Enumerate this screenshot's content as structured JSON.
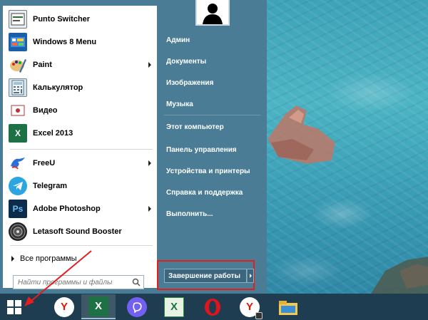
{
  "start_menu": {
    "pinned_apps": [
      {
        "label": "Punto Switcher",
        "icon": "punto-switcher-icon",
        "has_submenu": false
      },
      {
        "label": "Windows 8 Menu",
        "icon": "windows8-menu-icon",
        "has_submenu": false
      },
      {
        "label": "Paint",
        "icon": "paint-icon",
        "has_submenu": true
      },
      {
        "label": "Калькулятор",
        "icon": "calculator-icon",
        "has_submenu": false
      },
      {
        "label": "Видео",
        "icon": "video-icon",
        "has_submenu": false
      },
      {
        "label": "Excel 2013",
        "icon": "excel-icon",
        "has_submenu": false
      }
    ],
    "recent_apps": [
      {
        "label": "FreeU",
        "icon": "freeu-icon",
        "has_submenu": true
      },
      {
        "label": "Telegram",
        "icon": "telegram-icon",
        "has_submenu": false
      },
      {
        "label": "Adobe Photoshop",
        "icon": "photoshop-icon",
        "has_submenu": true
      },
      {
        "label": "Letasoft Sound Booster",
        "icon": "sound-booster-icon",
        "has_submenu": false
      }
    ],
    "all_programs": "Все программы",
    "search": {
      "placeholder": "Найти программы и файлы"
    },
    "right_items": [
      "Админ",
      "Документы",
      "Изображения",
      "Музыка",
      "Этот компьютер",
      "Панель управления",
      "Устройства и принтеры",
      "Справка и поддержка",
      "Выполнить..."
    ],
    "shutdown_label": "Завершение работы"
  },
  "taskbar": {
    "items": [
      {
        "name": "yandex-browser",
        "icon": "yandex-icon",
        "active": false
      },
      {
        "name": "excel",
        "icon": "excel-icon",
        "active": true
      },
      {
        "name": "viber",
        "icon": "viber-icon",
        "active": false
      },
      {
        "name": "excel-viewer",
        "icon": "excel-viewer-icon",
        "active": false
      },
      {
        "name": "opera",
        "icon": "opera-icon",
        "active": false
      },
      {
        "name": "yandex-update",
        "icon": "yandex-lock-icon",
        "active": false
      },
      {
        "name": "file-explorer",
        "icon": "folder-icon",
        "active": false
      }
    ]
  },
  "colors": {
    "menu_bg": "#4a7c95",
    "taskbar_bg": "#1f3d50",
    "highlight_red": "#e41e1e"
  }
}
